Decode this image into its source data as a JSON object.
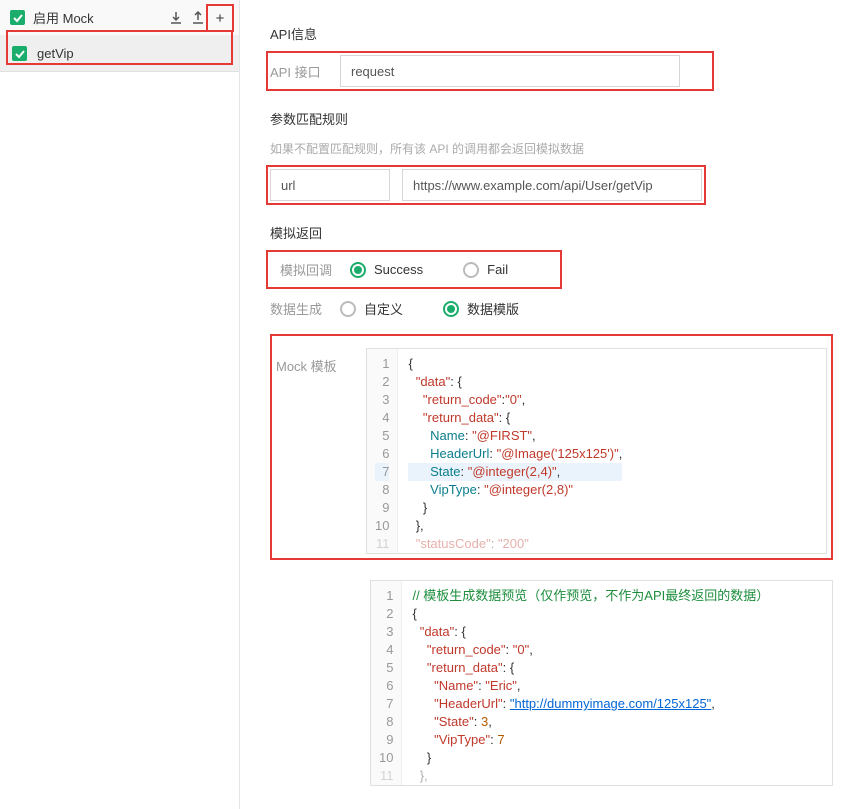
{
  "sidebar": {
    "enable_label": "启用 Mock",
    "items": [
      {
        "label": "getVip"
      }
    ]
  },
  "api": {
    "section_title": "API信息",
    "label": "API 接口",
    "value": "request"
  },
  "params": {
    "section_title": "参数匹配规则",
    "hint": "如果不配置匹配规则，所有该 API 的调用都会返回模拟数据",
    "key": "url",
    "value": "https://www.example.com/api/User/getVip"
  },
  "return": {
    "section_title": "模拟返回",
    "callback_label": "模拟回调",
    "success": "Success",
    "fail": "Fail",
    "gen_label": "数据生成",
    "custom": "自定义",
    "template": "数据模版"
  },
  "mock": {
    "label": "Mock 模板",
    "code": {
      "l1": "{",
      "l2a": "\"data\"",
      "l2b": ": {",
      "l3a": "\"return_code\"",
      "l3b": ":",
      "l3c": "\"0\"",
      "l3d": ",",
      "l4a": "\"return_data\"",
      "l4b": ": {",
      "l5a": "Name",
      "l5b": ": ",
      "l5c": "\"@FIRST\"",
      "l5d": ",",
      "l6a": "HeaderUrl",
      "l6b": ": ",
      "l6c": "\"@Image('125x125')\"",
      "l6d": ",",
      "l7a": "State",
      "l7b": ": ",
      "l7c": "\"@integer(2,4)\"",
      "l7d": ",",
      "l8a": "VipType",
      "l8b": ": ",
      "l8c": "\"@integer(2,8)\"",
      "l9": "}",
      "l10": "},",
      "l11a": "\"statusCode\"",
      "l11b": ": ",
      "l11c": "\"200\""
    }
  },
  "preview": {
    "comment": "// 模板生成数据预览（仅作预览，不作为API最终返回的数据）",
    "code": {
      "l2": "{",
      "l3a": "\"data\"",
      "l3b": ": {",
      "l4a": "\"return_code\"",
      "l4b": ": ",
      "l4c": "\"0\"",
      "l4d": ",",
      "l5a": "\"return_data\"",
      "l5b": ": {",
      "l6a": "\"Name\"",
      "l6b": ": ",
      "l6c": "\"Eric\"",
      "l6d": ",",
      "l7a": "\"HeaderUrl\"",
      "l7b": ": ",
      "l7c": "\"http://dummyimage.com/125x125\"",
      "l7d": ",",
      "l8a": "\"State\"",
      "l8b": ": ",
      "l8c": "3",
      "l8d": ",",
      "l9a": "\"VipType\"",
      "l9b": ": ",
      "l9c": "7",
      "l10": "}",
      "l11": "},"
    }
  }
}
